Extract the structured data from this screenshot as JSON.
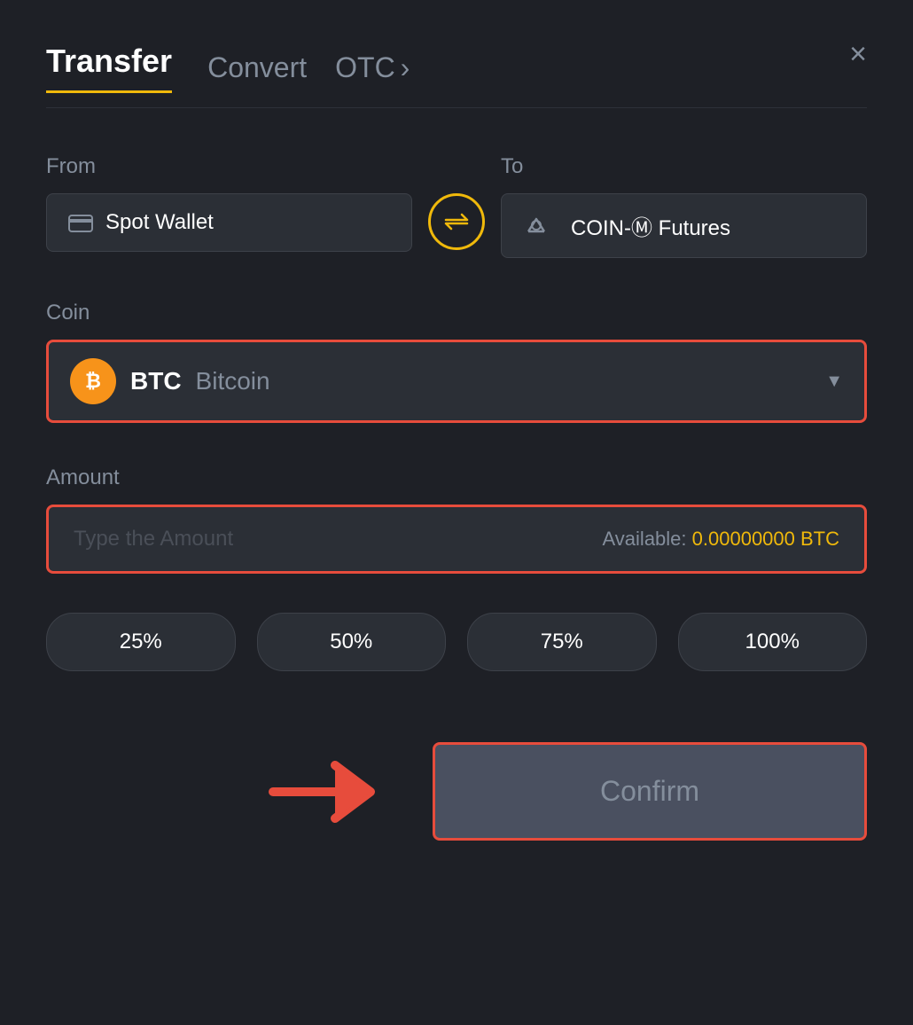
{
  "header": {
    "tab_transfer": "Transfer",
    "tab_convert": "Convert",
    "tab_otc": "OTC",
    "close_label": "×"
  },
  "from_section": {
    "label": "From",
    "wallet_name": "Spot Wallet"
  },
  "to_section": {
    "label": "To",
    "wallet_name": "COIN-Ⓜ Futures"
  },
  "coin_section": {
    "label": "Coin",
    "coin_symbol": "BTC",
    "coin_name": "Bitcoin"
  },
  "amount_section": {
    "label": "Amount",
    "placeholder": "Type the Amount",
    "available_label": "Available:",
    "available_amount": "0.00000000 BTC"
  },
  "pct_buttons": [
    {
      "label": "25%",
      "value": 25
    },
    {
      "label": "50%",
      "value": 50
    },
    {
      "label": "75%",
      "value": 75
    },
    {
      "label": "100%",
      "value": 100
    }
  ],
  "confirm_button": {
    "label": "Confirm"
  },
  "colors": {
    "accent": "#f0b90b",
    "danger": "#e74c3c",
    "bg": "#1e2026",
    "card_bg": "#2b2f36",
    "text_muted": "#848e9c",
    "text_white": "#ffffff"
  }
}
